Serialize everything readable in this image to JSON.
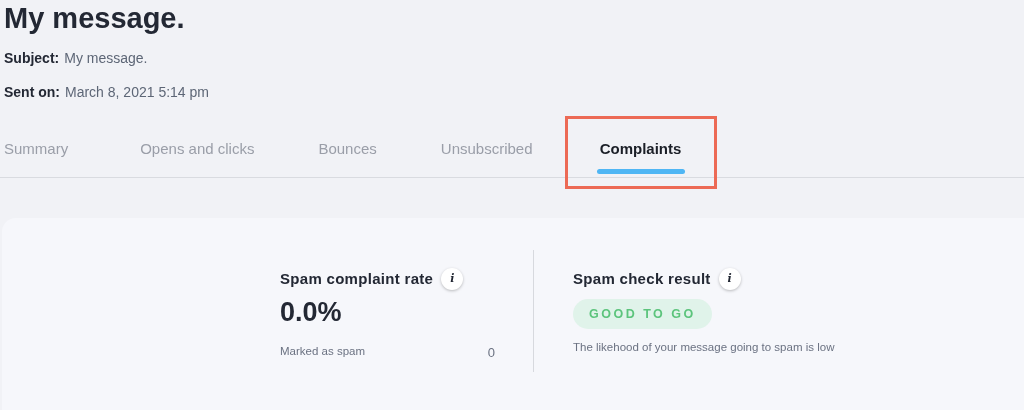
{
  "title": "My message.",
  "meta": [
    {
      "label": "Subject:",
      "value": "My message."
    },
    {
      "label": "Sent on:",
      "value": "March 8, 2021 5:14 pm"
    }
  ],
  "tabs": [
    {
      "label": "Summary",
      "selected": false,
      "highlighted": false
    },
    {
      "label": "Opens and clicks",
      "selected": false,
      "highlighted": false
    },
    {
      "label": "Bounces",
      "selected": false,
      "highlighted": false
    },
    {
      "label": "Unsubscribed",
      "selected": false,
      "highlighted": false
    },
    {
      "label": "Complaints",
      "selected": true,
      "highlighted": true
    }
  ],
  "complaint_rate": {
    "title": "Spam complaint rate",
    "info": "i",
    "value": "0.0%",
    "detail_label": "Marked as spam",
    "detail_value": "0"
  },
  "spam_check": {
    "title": "Spam check result",
    "info": "i",
    "badge": "GOOD TO GO",
    "description": "The likehood of your message going to spam is low"
  }
}
